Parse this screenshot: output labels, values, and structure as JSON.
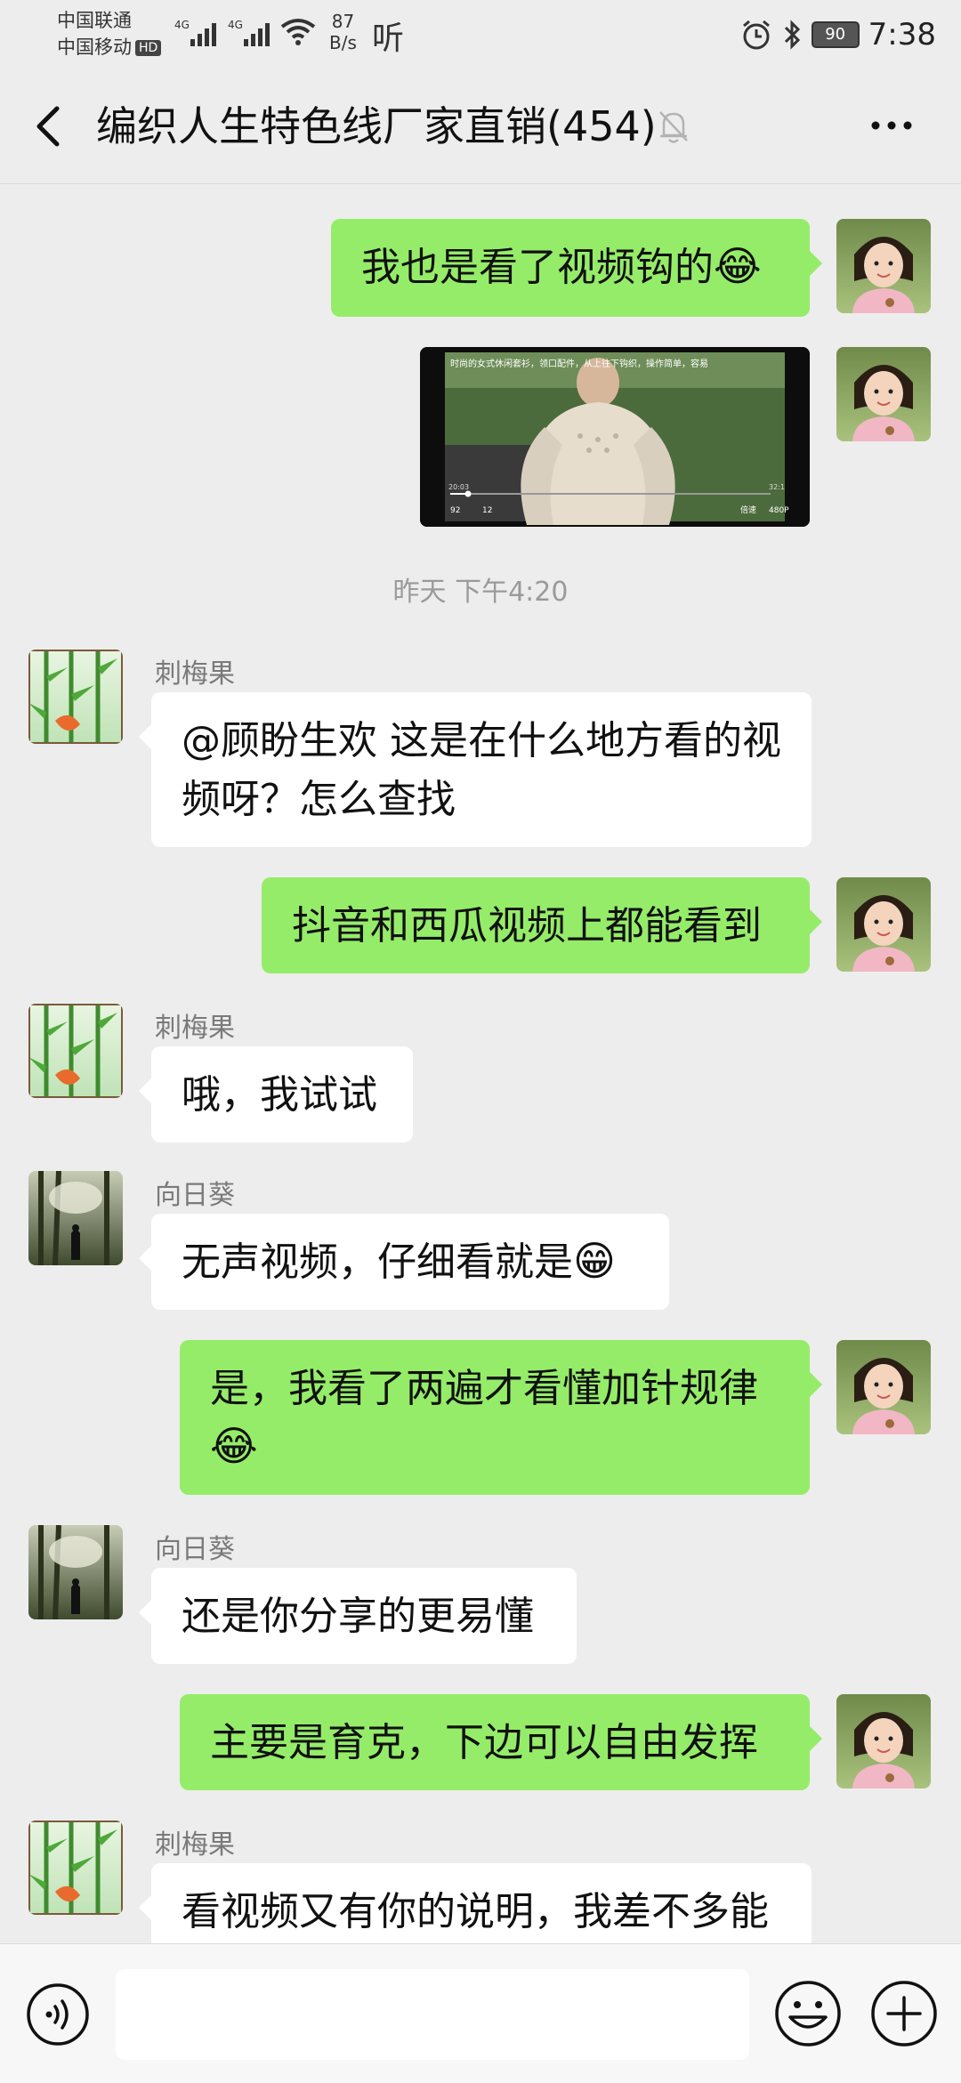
{
  "status_bar": {
    "carrier1": "中国联通",
    "carrier2": "中国移动",
    "hd": "HD",
    "net_type": "4G",
    "net_speed_value": "87",
    "net_speed_unit": "B/s",
    "ting": "听",
    "battery": "90",
    "time": "7:38"
  },
  "header": {
    "title": "编织人生特色线厂家直销(454)"
  },
  "colors": {
    "my_bubble": "#95ec69",
    "other_bubble": "#ffffff",
    "background": "#ededed"
  },
  "messages": {
    "m1": {
      "text": "我也是看了视频钩的"
    },
    "video": {
      "caption": "时尚的女式休闲套衫，领口配件，从上往下钩织，操作简单，容易",
      "time_start": "20:03",
      "time_end": "32:1",
      "likes": "92",
      "comments": "12",
      "speed_label": "倍速",
      "quality_label": "480P"
    },
    "timestamp": "昨天 下午4:20",
    "m2": {
      "sender": "刺梅果",
      "text": "@顾盼生欢  这是在什么地方看的视频呀？怎么查找"
    },
    "m3": {
      "text": "抖音和西瓜视频上都能看到"
    },
    "m4": {
      "sender": "刺梅果",
      "text": "哦，我试试"
    },
    "m5": {
      "sender": "向日葵",
      "text": "无声视频，仔细看就是"
    },
    "m6": {
      "text": "是，我看了两遍才看懂加针规律"
    },
    "m7": {
      "sender": "向日葵",
      "text": "还是你分享的更易懂"
    },
    "m8": {
      "text": "主要是育克，下边可以自由发挥"
    },
    "m9": {
      "sender": "刺梅果",
      "text": "看视频又有你的说明，我差不多能"
    }
  },
  "icons": {
    "laugh_cry": "😂",
    "grin": "😁"
  },
  "input": {
    "value": ""
  }
}
